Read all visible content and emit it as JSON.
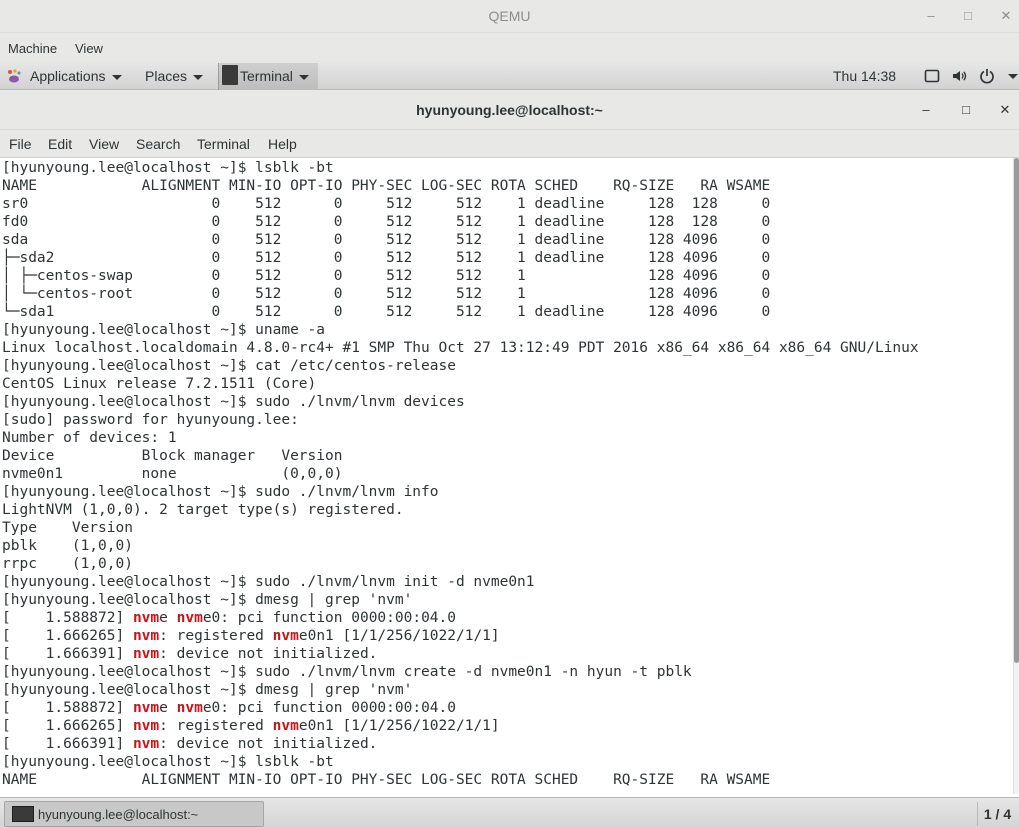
{
  "qemu": {
    "title": "QEMU",
    "minimize": "–",
    "maximize": "□",
    "close": "✕",
    "menu": [
      "Machine",
      "View"
    ]
  },
  "panel": {
    "applications": "Applications",
    "places": "Places",
    "terminal": "Terminal",
    "clock": "Thu 14:38",
    "icons": [
      "display-icon",
      "volume-icon",
      "power-icon"
    ]
  },
  "terminal_window": {
    "title": "hyunyoung.lee@localhost:~",
    "minimize": "–",
    "maximize": "□",
    "close": "✕",
    "menu": [
      "File",
      "Edit",
      "View",
      "Search",
      "Terminal",
      "Help"
    ]
  },
  "terminal": {
    "highlight_color": "#c4161c",
    "lines": [
      [
        {
          "t": "[hyunyoung.lee@localhost ~]$ lsblk -bt"
        }
      ],
      [
        {
          "t": "NAME            ALIGNMENT MIN-IO OPT-IO PHY-SEC LOG-SEC ROTA SCHED    RQ-SIZE   RA WSAME"
        }
      ],
      [
        {
          "t": "sr0                     0    512      0     512     512    1 deadline     128  128     0"
        }
      ],
      [
        {
          "t": "fd0                     0    512      0     512     512    1 deadline     128  128     0"
        }
      ],
      [
        {
          "t": "sda                     0    512      0     512     512    1 deadline     128 4096     0"
        }
      ],
      [
        {
          "t": "├─sda2                  0    512      0     512     512    1 deadline     128 4096     0"
        }
      ],
      [
        {
          "t": "│ ├─centos-swap         0    512      0     512     512    1              128 4096     0"
        }
      ],
      [
        {
          "t": "│ └─centos-root         0    512      0     512     512    1              128 4096     0"
        }
      ],
      [
        {
          "t": "└─sda1                  0    512      0     512     512    1 deadline     128 4096     0"
        }
      ],
      [
        {
          "t": "[hyunyoung.lee@localhost ~]$ uname -a"
        }
      ],
      [
        {
          "t": "Linux localhost.localdomain 4.8.0-rc4+ #1 SMP Thu Oct 27 13:12:49 PDT 2016 x86_64 x86_64 x86_64 GNU/Linux"
        }
      ],
      [
        {
          "t": "[hyunyoung.lee@localhost ~]$ cat /etc/centos-release"
        }
      ],
      [
        {
          "t": "CentOS Linux release 7.2.1511 (Core)"
        }
      ],
      [
        {
          "t": "[hyunyoung.lee@localhost ~]$ sudo ./lnvm/lnvm devices"
        }
      ],
      [
        {
          "t": "[sudo] password for hyunyoung.lee:"
        }
      ],
      [
        {
          "t": "Number of devices: 1"
        }
      ],
      [
        {
          "t": "Device          Block manager   Version"
        }
      ],
      [
        {
          "t": "nvme0n1         none            (0,0,0)"
        }
      ],
      [
        {
          "t": "[hyunyoung.lee@localhost ~]$ sudo ./lnvm/lnvm info"
        }
      ],
      [
        {
          "t": "LightNVM (1,0,0). 2 target type(s) registered."
        }
      ],
      [
        {
          "t": "Type    Version"
        }
      ],
      [
        {
          "t": "pblk    (1,0,0)"
        }
      ],
      [
        {
          "t": "rrpc    (1,0,0)"
        }
      ],
      [
        {
          "t": "[hyunyoung.lee@localhost ~]$ sudo ./lnvm/lnvm init -d nvme0n1"
        }
      ],
      [
        {
          "t": "[hyunyoung.lee@localhost ~]$ dmesg | grep 'nvm'"
        }
      ],
      [
        {
          "t": "[    1.588872] "
        },
        {
          "t": "nvm",
          "h": true
        },
        {
          "t": "e "
        },
        {
          "t": "nvm",
          "h": true
        },
        {
          "t": "e0: pci function 0000:00:04.0"
        }
      ],
      [
        {
          "t": "[    1.666265] "
        },
        {
          "t": "nvm",
          "h": true
        },
        {
          "t": ": registered "
        },
        {
          "t": "nvm",
          "h": true
        },
        {
          "t": "e0n1 [1/1/256/1022/1/1]"
        }
      ],
      [
        {
          "t": "[    1.666391] "
        },
        {
          "t": "nvm",
          "h": true
        },
        {
          "t": ": device not initialized."
        }
      ],
      [
        {
          "t": "[hyunyoung.lee@localhost ~]$ sudo ./lnvm/lnvm create -d nvme0n1 -n hyun -t pblk"
        }
      ],
      [
        {
          "t": "[hyunyoung.lee@localhost ~]$ dmesg | grep 'nvm'"
        }
      ],
      [
        {
          "t": "[    1.588872] "
        },
        {
          "t": "nvm",
          "h": true
        },
        {
          "t": "e "
        },
        {
          "t": "nvm",
          "h": true
        },
        {
          "t": "e0: pci function 0000:00:04.0"
        }
      ],
      [
        {
          "t": "[    1.666265] "
        },
        {
          "t": "nvm",
          "h": true
        },
        {
          "t": ": registered "
        },
        {
          "t": "nvm",
          "h": true
        },
        {
          "t": "e0n1 [1/1/256/1022/1/1]"
        }
      ],
      [
        {
          "t": "[    1.666391] "
        },
        {
          "t": "nvm",
          "h": true
        },
        {
          "t": ": device not initialized."
        }
      ],
      [
        {
          "t": "[hyunyoung.lee@localhost ~]$ lsblk -bt"
        }
      ],
      [
        {
          "t": "NAME            ALIGNMENT MIN-IO OPT-IO PHY-SEC LOG-SEC ROTA SCHED    RQ-SIZE   RA WSAME"
        }
      ]
    ]
  },
  "taskbar": {
    "task_label": "hyunyoung.lee@localhost:~",
    "workspace": "1 / 4"
  }
}
